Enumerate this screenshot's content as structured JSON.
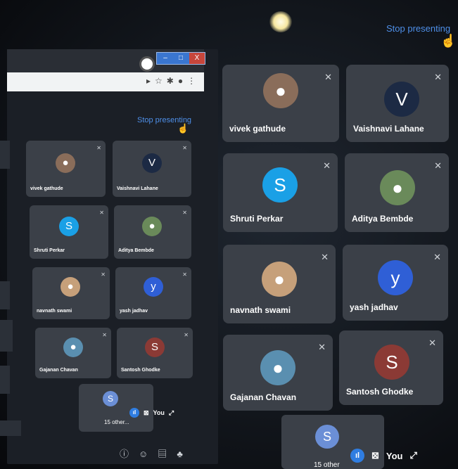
{
  "inner_screen": {
    "stop_presenting": "Stop presenting",
    "window_buttons": {
      "minimize": "–",
      "maximize": "□",
      "close": "X"
    },
    "participants": [
      {
        "name": "vivek gathude",
        "avatar": "photo",
        "color": "#8a6d5a"
      },
      {
        "name": "Vaishnavi Lahane",
        "avatar": "V",
        "color": "#1c2a44"
      },
      {
        "name": "Shruti Perkar",
        "avatar": "S",
        "color": "#1aa0e6"
      },
      {
        "name": "Aditya Bembde",
        "avatar": "photo",
        "color": "#6a8a5a"
      },
      {
        "name": "navnath swami",
        "avatar": "photo",
        "color": "#c6a07a"
      },
      {
        "name": "yash jadhav",
        "avatar": "y",
        "color": "#2f5fd6"
      },
      {
        "name": "Gajanan Chavan",
        "avatar": "photo",
        "color": "#5a8fb0"
      },
      {
        "name": "Santosh Ghodke",
        "avatar": "S",
        "color": "#8b3a35"
      }
    ],
    "self_tile": {
      "others": "15 other...",
      "you": "You"
    },
    "toolbar_icons": [
      "info-icon",
      "people-icon",
      "chat-icon",
      "activities-icon"
    ]
  },
  "main_screen": {
    "stop_presenting": "Stop presenting",
    "participants": [
      {
        "name": "vivek gathude",
        "avatar": "photo",
        "color": "#8a6d5a"
      },
      {
        "name": "Vaishnavi Lahane",
        "avatar": "V",
        "color": "#1c2a44"
      },
      {
        "name": "Shruti Perkar",
        "avatar": "S",
        "color": "#1aa0e6"
      },
      {
        "name": "Aditya Bembde",
        "avatar": "photo",
        "color": "#6a8a5a"
      },
      {
        "name": "navnath swami",
        "avatar": "photo",
        "color": "#c6a07a"
      },
      {
        "name": "yash jadhav",
        "avatar": "y",
        "color": "#2f5fd6"
      },
      {
        "name": "Gajanan Chavan",
        "avatar": "photo",
        "color": "#5a8fb0"
      },
      {
        "name": "Santosh Ghodke",
        "avatar": "S",
        "color": "#8b3a35"
      }
    ],
    "self_tile": {
      "others": "15 other",
      "you": "You"
    }
  }
}
